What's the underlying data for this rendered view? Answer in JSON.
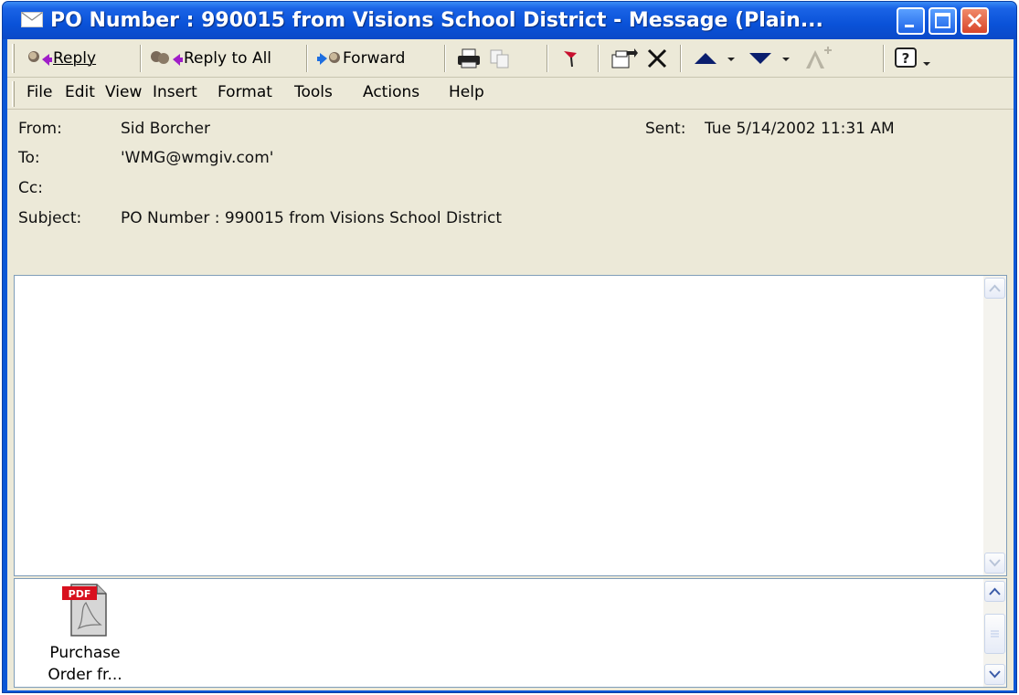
{
  "window": {
    "title": "PO Number : 990015 from Visions School District - Message (Plain...",
    "controls": [
      "minimize",
      "maximize",
      "close"
    ]
  },
  "toolbar": {
    "reply_label": "Reply",
    "reply_all_label": "Reply to All",
    "forward_label": "Forward",
    "icons": [
      "reply-icon",
      "reply-all-icon",
      "forward-icon",
      "print-icon",
      "copy-icon",
      "flag-icon",
      "move-to-folder-icon",
      "delete-icon",
      "previous-item-icon",
      "next-item-icon",
      "font-size-icon",
      "help-icon"
    ]
  },
  "menu": {
    "items": [
      "File",
      "Edit",
      "View",
      "Insert",
      "Format",
      "Tools",
      "Actions",
      "Help"
    ]
  },
  "header": {
    "from_label": "From:",
    "from_value": "Sid Borcher",
    "sent_label": "Sent:",
    "sent_value": "Tue 5/14/2002 11:31 AM",
    "to_label": "To:",
    "to_value": "'WMG@wmgiv.com'",
    "cc_label": "Cc:",
    "cc_value": "",
    "subject_label": "Subject:",
    "subject_value": "PO Number : 990015 from Visions School District"
  },
  "attachment": {
    "badge": "PDF",
    "label_line1": "Purchase",
    "label_line2": "Order fr..."
  },
  "colors": {
    "title_bar": "#0a52d8",
    "chrome": "#ece9d8",
    "pane_border": "#7f9db9"
  }
}
